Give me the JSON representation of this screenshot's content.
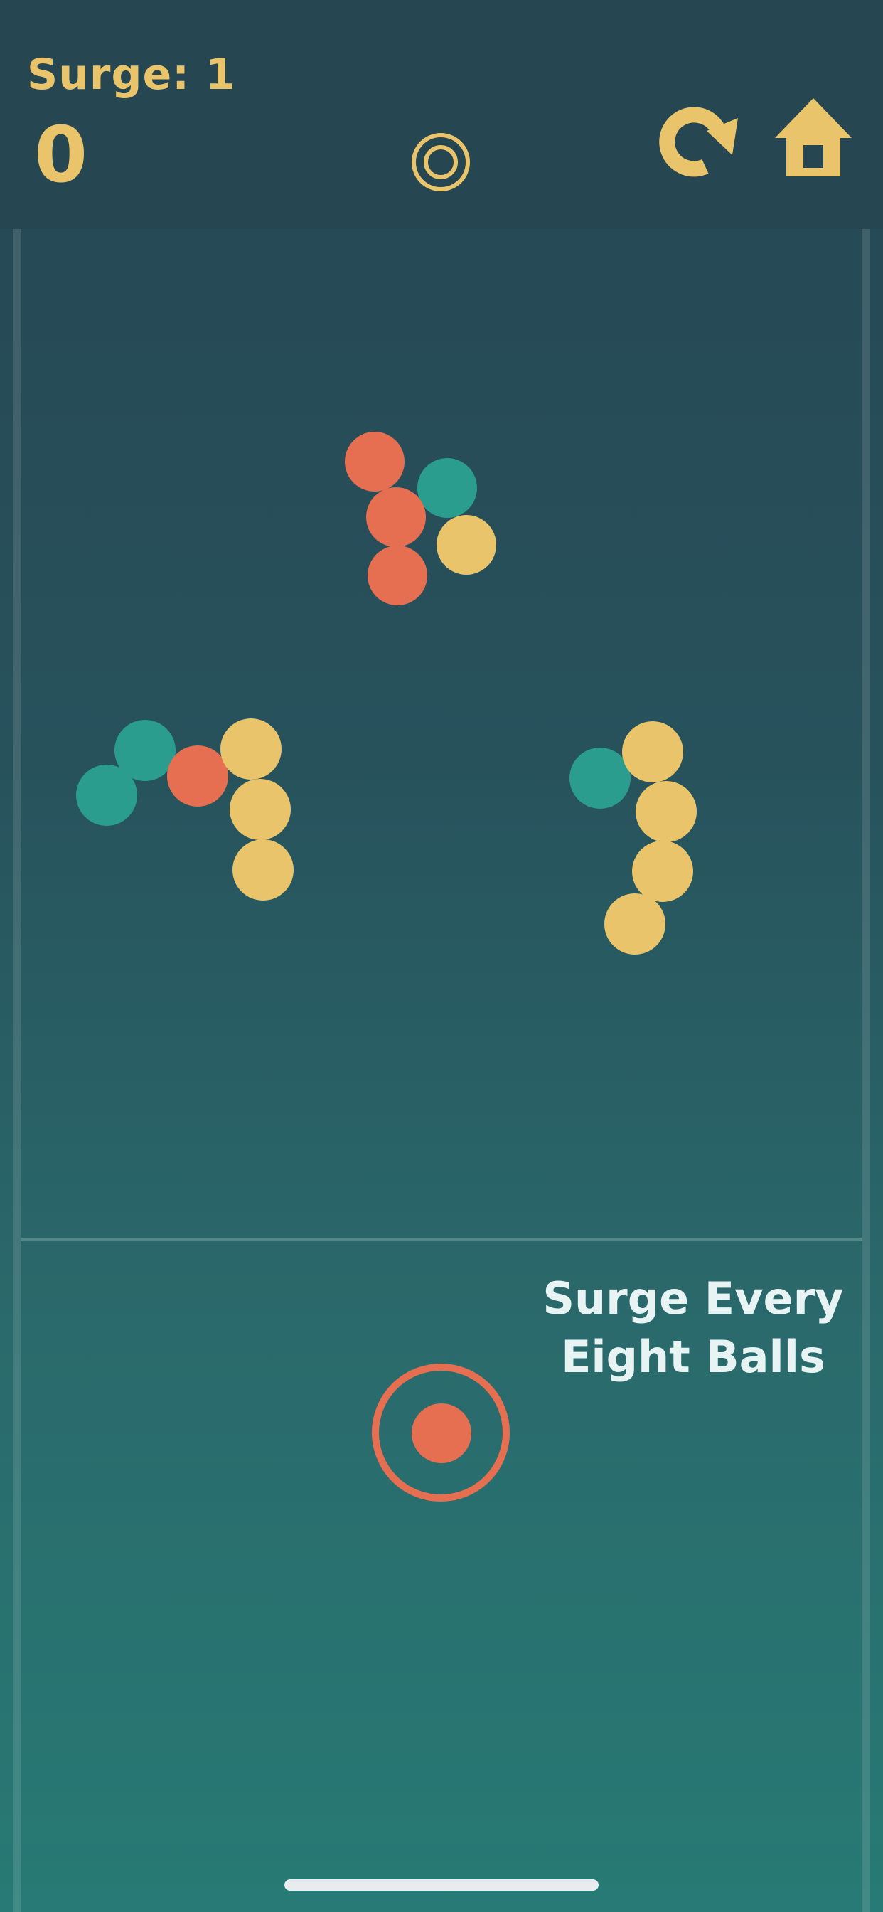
{
  "header": {
    "surge_text": "Surge: 1",
    "score": "0"
  },
  "icons": {
    "center": "target-rings-icon",
    "restart": "restart-arrow-icon",
    "home": "home-icon"
  },
  "hint": {
    "text": "Surge Every\nEight Balls"
  },
  "colors": {
    "background_top": "#264653",
    "background_bottom": "#277a75",
    "accent_yellow": "#e9c46a",
    "ball_red": "#e76f51",
    "ball_teal": "#2a9d8f",
    "ball_yellow": "#e9c46a"
  },
  "balls": {
    "cluster_top": [
      "red",
      "teal",
      "red",
      "yellow",
      "red"
    ],
    "cluster_left": [
      "teal",
      "teal",
      "red",
      "yellow",
      "yellow",
      "yellow"
    ],
    "cluster_right": [
      "teal",
      "yellow",
      "yellow",
      "yellow",
      "yellow"
    ]
  },
  "launcher": {
    "ball_color": "red"
  }
}
